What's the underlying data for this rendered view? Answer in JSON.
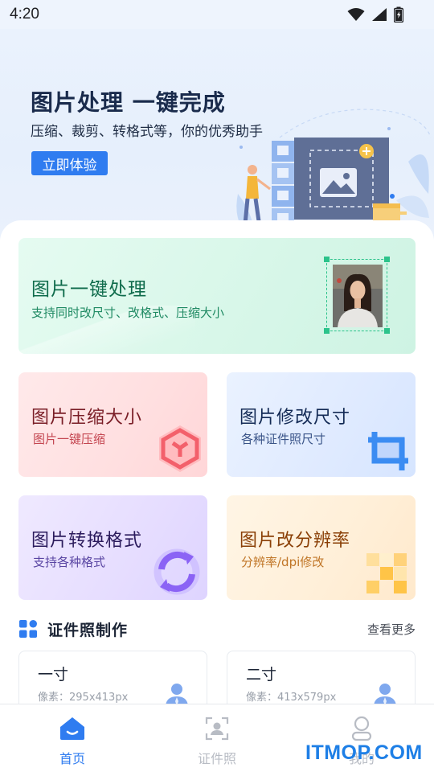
{
  "status_bar": {
    "time": "4:20",
    "icons": [
      "wifi-icon",
      "signal-icon",
      "battery-icon"
    ]
  },
  "hero": {
    "title": "图片处理 一键完成",
    "subtitle": "压缩、裁剪、转格式等，你的优秀助手",
    "cta_label": "立即体验"
  },
  "features": {
    "main": {
      "title": "图片一键处理",
      "desc": "支持同时改尺寸、改格式、压缩大小"
    },
    "compress": {
      "title": "图片压缩大小",
      "desc": "图片一键压缩"
    },
    "resize": {
      "title": "图片修改尺寸",
      "desc": "各种证件照尺寸"
    },
    "convert": {
      "title": "图片转换格式",
      "desc": "支持各种格式"
    },
    "dpi": {
      "title": "图片改分辨率",
      "desc": "分辨率/dpi修改"
    }
  },
  "id_section": {
    "title": "证件照制作",
    "more_label": "查看更多",
    "items": [
      {
        "name": "一寸",
        "pixels": "像素：295x413px"
      },
      {
        "name": "二寸",
        "pixels": "像素：413x579px"
      }
    ]
  },
  "bottom_nav": {
    "items": [
      {
        "label": "首页",
        "icon": "home-icon",
        "active": true
      },
      {
        "label": "证件照",
        "icon": "id-photo-icon",
        "active": false
      },
      {
        "label": "我的",
        "icon": "profile-icon",
        "active": false
      }
    ]
  },
  "watermark": "ITMOP.COM",
  "colors": {
    "accent": "#2f7cf0",
    "main_card": "#d8f7e9",
    "compress_card": "#ffdfe0",
    "resize_card": "#dfeaff",
    "convert_card": "#e6ddff",
    "dpi_card": "#ffefd8"
  }
}
